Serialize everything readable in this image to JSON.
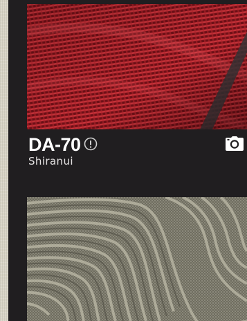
{
  "product": {
    "code": "DA-70",
    "name": "Shiranui"
  },
  "icons": {
    "info": "info-circle-icon",
    "camera": "camera-icon"
  },
  "colors": {
    "background": "#201e20",
    "text": "#ffffff",
    "swatch_top": "#a01c24",
    "swatch_bottom": "#8a8878"
  }
}
